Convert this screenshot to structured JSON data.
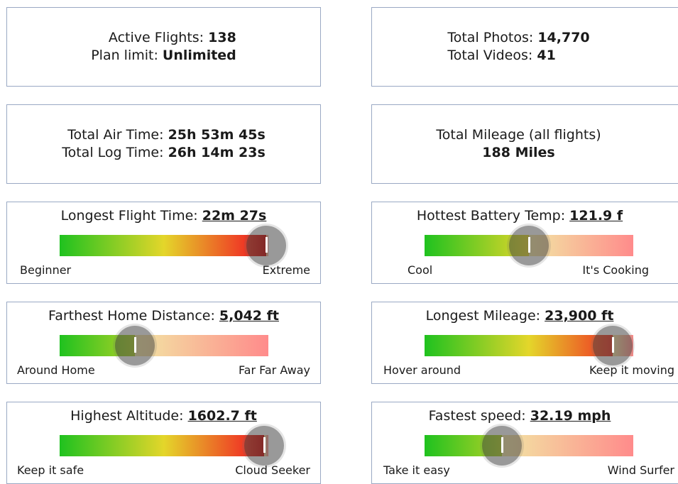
{
  "cards": {
    "flights": {
      "active_label": "Active Flights:",
      "active_value": "138",
      "plan_label": "Plan limit:",
      "plan_value": "Unlimited"
    },
    "media": {
      "photos_label": "Total Photos:",
      "photos_value": "14,770",
      "videos_label": "Total Videos:",
      "videos_value": "41"
    },
    "time": {
      "air_label": "Total Air Time:",
      "air_value": "25h 53m 45s",
      "log_label": "Total Log Time:",
      "log_value": "26h 14m 23s"
    },
    "mileage": {
      "label": "Total Mileage (all flights)",
      "value": "188 Miles"
    }
  },
  "meters": [
    {
      "title": "Longest Flight Time:",
      "value": "22m 27s",
      "min_label": "Beginner",
      "max_label": "Extreme",
      "level": 0.99
    },
    {
      "title": "Hottest Battery Temp:",
      "value": "121.9 f",
      "min_label": "Cool",
      "max_label": "It's Cooking",
      "level": 0.5
    },
    {
      "title": "Farthest Home Distance:",
      "value": "5,042 ft",
      "min_label": "Around Home",
      "max_label": "Far Far Away",
      "level": 0.36
    },
    {
      "title": "Longest Mileage:",
      "value": "23,900 ft",
      "min_label": "Hover around",
      "max_label": "Keep it moving",
      "level": 0.9
    },
    {
      "title": "Highest Altitude:",
      "value": "1602.7 ft",
      "min_label": "Keep it safe",
      "max_label": "Cloud Seeker",
      "level": 0.98
    },
    {
      "title": "Fastest speed:",
      "value": "32.19 mph",
      "min_label": "Take it easy",
      "max_label": "Wind Surfer",
      "level": 0.37
    }
  ],
  "colors": {
    "gradient": [
      "#1fc21f",
      "#e4d62a",
      "#ef3b25",
      "#cc0000"
    ],
    "rest": [
      "#f2e6a4",
      "#ff8b8b"
    ],
    "border": "#9aa9c4"
  }
}
